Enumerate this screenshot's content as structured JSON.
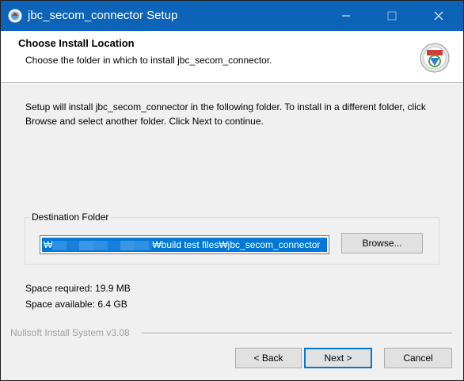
{
  "window": {
    "title": "jbc_secom_connector Setup",
    "controls": {
      "minimize_icon": "minimize-icon",
      "maximize_icon": "maximize-icon",
      "close_icon": "close-icon"
    }
  },
  "header": {
    "title": "Choose Install Location",
    "subtitle": "Choose the folder in which to install jbc_secom_connector.",
    "logo_icon": "nsis-installer-icon"
  },
  "intro_text": "Setup will install jbc_secom_connector in the following folder. To install in a different folder, click Browse and select another folder. Click Next to continue.",
  "destination": {
    "group_label": "Destination Folder",
    "path_prefix": "₩",
    "path_suffix": "₩build test files₩jbc_secom_connector",
    "browse_label": "Browse..."
  },
  "space": {
    "required": "Space required: 19.9 MB",
    "available": "Space available: 6.4 GB"
  },
  "branding": "Nullsoft Install System v3.08",
  "buttons": {
    "back": "< Back",
    "next": "Next >",
    "cancel": "Cancel"
  },
  "colors": {
    "titlebar": "#0c63b8",
    "selection": "#0078d7",
    "default_button_border": "#0078d7"
  }
}
